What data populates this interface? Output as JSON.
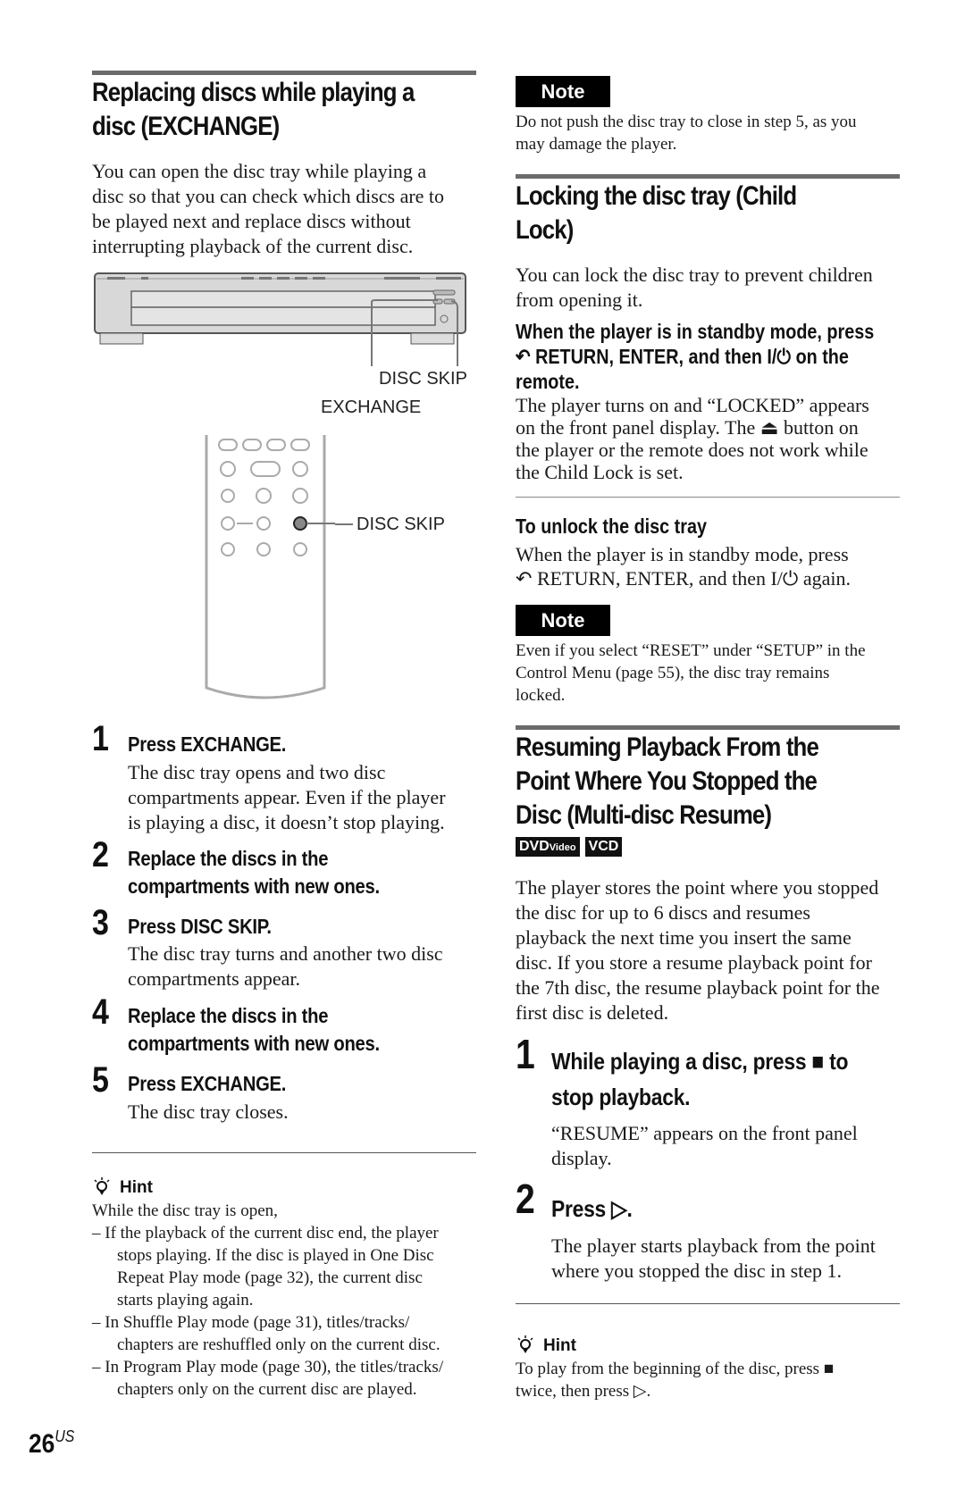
{
  "page": {
    "number": "26",
    "region": "US"
  },
  "left": {
    "section_title": "Replacing discs while playing a disc (EXCHANGE)",
    "title_lines": [
      "Replacing discs while playing a",
      "disc (EXCHANGE)"
    ],
    "intro_lines": [
      "You can open the disc tray while playing a",
      "disc so that you can check which discs are to",
      "be played next and replace discs without",
      "interrupting playback of the current disc."
    ],
    "diagram": {
      "player_labels": {
        "disc_skip": "DISC SKIP",
        "exchange": "EXCHANGE"
      },
      "remote_labels": {
        "disc_skip": "DISC SKIP"
      }
    },
    "steps": [
      {
        "num": "1",
        "title_lines": [
          "Press EXCHANGE."
        ],
        "body_lines": [
          "The disc tray opens and two disc",
          "compartments appear. Even if the player",
          "is playing a disc, it doesn’t stop playing."
        ]
      },
      {
        "num": "2",
        "title_lines": [
          "Replace the discs in the",
          "compartments with new ones."
        ],
        "body_lines": []
      },
      {
        "num": "3",
        "title_lines": [
          "Press DISC SKIP."
        ],
        "body_lines": [
          "The disc tray turns and another two disc",
          "compartments appear."
        ]
      },
      {
        "num": "4",
        "title_lines": [
          "Replace the discs in the",
          "compartments with new ones."
        ],
        "body_lines": []
      },
      {
        "num": "5",
        "title_lines": [
          "Press EXCHANGE."
        ],
        "body_lines": [
          "The disc tray closes."
        ]
      }
    ],
    "hint": {
      "label": "Hint",
      "icon": "lightbulb-icon",
      "intro": "While the disc tray is open,",
      "items": [
        [
          "– If the playback of the current disc end, the player",
          "stops playing. If the disc is played in One Disc",
          "Repeat Play mode (page 32), the current disc",
          "starts playing again."
        ],
        [
          "– In Shuffle Play mode (page 31), titles/tracks/",
          "chapters are reshuffled only on the current disc."
        ],
        [
          "– In Program Play mode (page 30), the titles/tracks/",
          "chapters only on the current disc are played."
        ]
      ]
    }
  },
  "right": {
    "note1": {
      "label": "Note",
      "lines": [
        "Do not push the disc tray to close in step 5, as you",
        "may damage the player."
      ]
    },
    "child_lock": {
      "title_lines": [
        "Locking the disc tray (Child",
        "Lock)"
      ],
      "intro_lines": [
        "You can lock the disc tray to prevent children",
        "from opening it."
      ],
      "instruction_lines": [
        "When the player is in standby mode, press",
        "RETURN, ENTER, and then",
        "remote."
      ],
      "instruction_tail": "on the",
      "power_symbol": "I/⏻",
      "return_icon": "return-icon",
      "result_lines": [
        "The player turns on and “LOCKED” appears",
        "on the front panel display. The",
        "button on",
        "the player or the remote does not work while",
        "the Child Lock is set."
      ],
      "eject_symbol": "⏏",
      "unlock_title": "To unlock the disc tray",
      "unlock_lines": [
        "When the player is in standby mode, press",
        "RETURN, ENTER, and then",
        "again."
      ]
    },
    "note2": {
      "label": "Note",
      "lines": [
        "Even if you select “RESET” under “SETUP” in the",
        "Control Menu (page 55), the disc tray remains",
        "locked."
      ]
    },
    "resume": {
      "title_lines": [
        "Resuming Playback From the",
        "Point Where You Stopped the",
        "Disc (Multi-disc Resume)"
      ],
      "badges": [
        {
          "main": "DVD",
          "sub": "Video"
        },
        {
          "main": "VCD",
          "sub": ""
        }
      ],
      "intro_lines": [
        "The player stores the point where you stopped",
        "the disc for up to 6 discs and resumes",
        "playback the next time you insert the same",
        "disc. If you store a resume playback point for",
        "the 7th disc, the resume playback point for the",
        "first disc is deleted."
      ],
      "steps": [
        {
          "num": "1",
          "title_lines": [
            "While playing a disc, press",
            "stop playback."
          ],
          "title_tail": "to",
          "symbol": "■",
          "body_lines": [
            "“RESUME” appears on the front panel",
            "display."
          ]
        },
        {
          "num": "2",
          "title_lines": [
            "Press"
          ],
          "title_tail": ".",
          "symbol": "▷",
          "body_lines": [
            "The player starts playback from the point",
            "where you stopped the disc in step 1."
          ]
        }
      ],
      "hint": {
        "label": "Hint",
        "lines": [
          "To play from the beginning of the disc, press",
          "twice, then press"
        ],
        "stop_symbol": "■",
        "play_symbol": "▷",
        "tail": "."
      }
    }
  }
}
